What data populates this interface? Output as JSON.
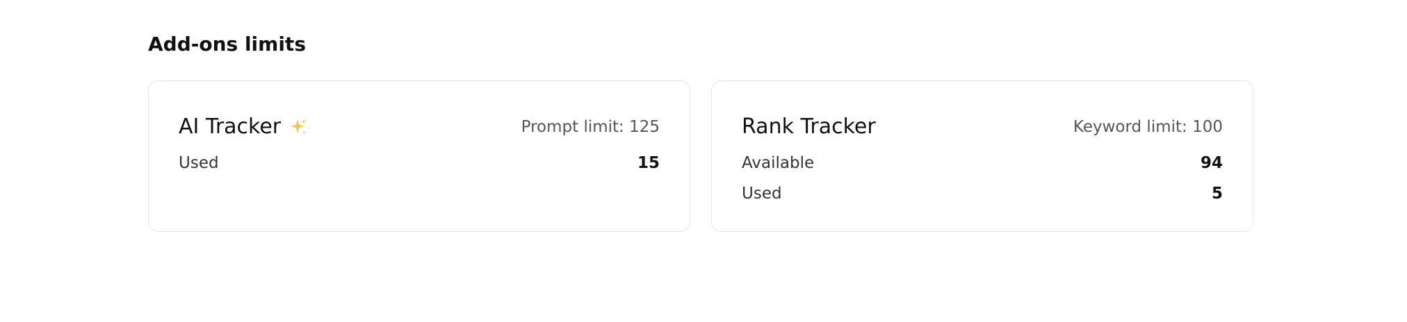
{
  "section": {
    "title": "Add-ons limits"
  },
  "cards": [
    {
      "title": "AI Tracker",
      "icon": "sparkle-icon",
      "limit_label": "Prompt limit: 125",
      "stats": [
        {
          "label": "Used",
          "value": "15"
        }
      ]
    },
    {
      "title": "Rank Tracker",
      "limit_label": "Keyword limit: 100",
      "stats": [
        {
          "label": "Available",
          "value": "94"
        },
        {
          "label": "Used",
          "value": "5"
        }
      ]
    }
  ],
  "colors": {
    "accent_sparkle": "#F2C94C",
    "border": "#E6E6E6",
    "text_primary": "#111111",
    "text_muted": "#555555"
  }
}
